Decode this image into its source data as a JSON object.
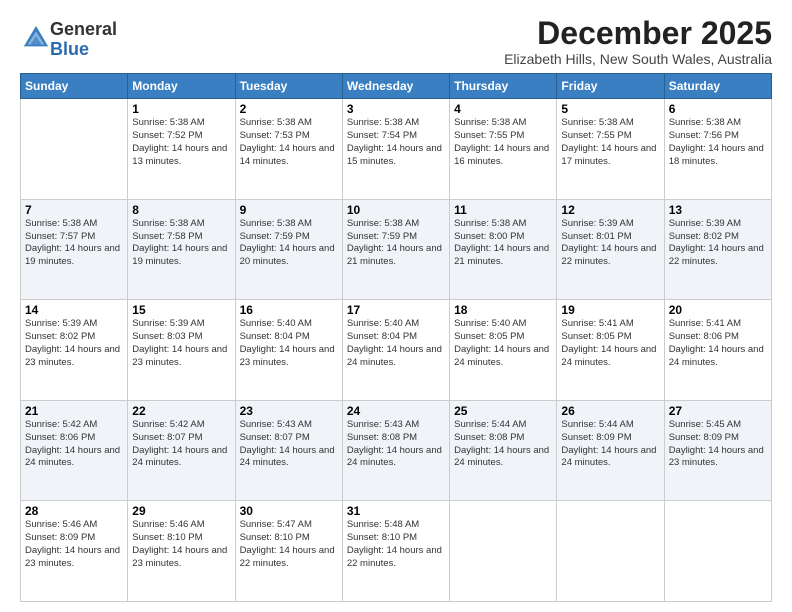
{
  "logo": {
    "general": "General",
    "blue": "Blue"
  },
  "title": {
    "month_year": "December 2025",
    "location": "Elizabeth Hills, New South Wales, Australia"
  },
  "days_of_week": [
    "Sunday",
    "Monday",
    "Tuesday",
    "Wednesday",
    "Thursday",
    "Friday",
    "Saturday"
  ],
  "weeks": [
    [
      {
        "day": "",
        "sunrise": "",
        "sunset": "",
        "daylight": ""
      },
      {
        "day": "1",
        "sunrise": "Sunrise: 5:38 AM",
        "sunset": "Sunset: 7:52 PM",
        "daylight": "Daylight: 14 hours and 13 minutes."
      },
      {
        "day": "2",
        "sunrise": "Sunrise: 5:38 AM",
        "sunset": "Sunset: 7:53 PM",
        "daylight": "Daylight: 14 hours and 14 minutes."
      },
      {
        "day": "3",
        "sunrise": "Sunrise: 5:38 AM",
        "sunset": "Sunset: 7:54 PM",
        "daylight": "Daylight: 14 hours and 15 minutes."
      },
      {
        "day": "4",
        "sunrise": "Sunrise: 5:38 AM",
        "sunset": "Sunset: 7:55 PM",
        "daylight": "Daylight: 14 hours and 16 minutes."
      },
      {
        "day": "5",
        "sunrise": "Sunrise: 5:38 AM",
        "sunset": "Sunset: 7:55 PM",
        "daylight": "Daylight: 14 hours and 17 minutes."
      },
      {
        "day": "6",
        "sunrise": "Sunrise: 5:38 AM",
        "sunset": "Sunset: 7:56 PM",
        "daylight": "Daylight: 14 hours and 18 minutes."
      }
    ],
    [
      {
        "day": "7",
        "sunrise": "Sunrise: 5:38 AM",
        "sunset": "Sunset: 7:57 PM",
        "daylight": "Daylight: 14 hours and 19 minutes."
      },
      {
        "day": "8",
        "sunrise": "Sunrise: 5:38 AM",
        "sunset": "Sunset: 7:58 PM",
        "daylight": "Daylight: 14 hours and 19 minutes."
      },
      {
        "day": "9",
        "sunrise": "Sunrise: 5:38 AM",
        "sunset": "Sunset: 7:59 PM",
        "daylight": "Daylight: 14 hours and 20 minutes."
      },
      {
        "day": "10",
        "sunrise": "Sunrise: 5:38 AM",
        "sunset": "Sunset: 7:59 PM",
        "daylight": "Daylight: 14 hours and 21 minutes."
      },
      {
        "day": "11",
        "sunrise": "Sunrise: 5:38 AM",
        "sunset": "Sunset: 8:00 PM",
        "daylight": "Daylight: 14 hours and 21 minutes."
      },
      {
        "day": "12",
        "sunrise": "Sunrise: 5:39 AM",
        "sunset": "Sunset: 8:01 PM",
        "daylight": "Daylight: 14 hours and 22 minutes."
      },
      {
        "day": "13",
        "sunrise": "Sunrise: 5:39 AM",
        "sunset": "Sunset: 8:02 PM",
        "daylight": "Daylight: 14 hours and 22 minutes."
      }
    ],
    [
      {
        "day": "14",
        "sunrise": "Sunrise: 5:39 AM",
        "sunset": "Sunset: 8:02 PM",
        "daylight": "Daylight: 14 hours and 23 minutes."
      },
      {
        "day": "15",
        "sunrise": "Sunrise: 5:39 AM",
        "sunset": "Sunset: 8:03 PM",
        "daylight": "Daylight: 14 hours and 23 minutes."
      },
      {
        "day": "16",
        "sunrise": "Sunrise: 5:40 AM",
        "sunset": "Sunset: 8:04 PM",
        "daylight": "Daylight: 14 hours and 23 minutes."
      },
      {
        "day": "17",
        "sunrise": "Sunrise: 5:40 AM",
        "sunset": "Sunset: 8:04 PM",
        "daylight": "Daylight: 14 hours and 24 minutes."
      },
      {
        "day": "18",
        "sunrise": "Sunrise: 5:40 AM",
        "sunset": "Sunset: 8:05 PM",
        "daylight": "Daylight: 14 hours and 24 minutes."
      },
      {
        "day": "19",
        "sunrise": "Sunrise: 5:41 AM",
        "sunset": "Sunset: 8:05 PM",
        "daylight": "Daylight: 14 hours and 24 minutes."
      },
      {
        "day": "20",
        "sunrise": "Sunrise: 5:41 AM",
        "sunset": "Sunset: 8:06 PM",
        "daylight": "Daylight: 14 hours and 24 minutes."
      }
    ],
    [
      {
        "day": "21",
        "sunrise": "Sunrise: 5:42 AM",
        "sunset": "Sunset: 8:06 PM",
        "daylight": "Daylight: 14 hours and 24 minutes."
      },
      {
        "day": "22",
        "sunrise": "Sunrise: 5:42 AM",
        "sunset": "Sunset: 8:07 PM",
        "daylight": "Daylight: 14 hours and 24 minutes."
      },
      {
        "day": "23",
        "sunrise": "Sunrise: 5:43 AM",
        "sunset": "Sunset: 8:07 PM",
        "daylight": "Daylight: 14 hours and 24 minutes."
      },
      {
        "day": "24",
        "sunrise": "Sunrise: 5:43 AM",
        "sunset": "Sunset: 8:08 PM",
        "daylight": "Daylight: 14 hours and 24 minutes."
      },
      {
        "day": "25",
        "sunrise": "Sunrise: 5:44 AM",
        "sunset": "Sunset: 8:08 PM",
        "daylight": "Daylight: 14 hours and 24 minutes."
      },
      {
        "day": "26",
        "sunrise": "Sunrise: 5:44 AM",
        "sunset": "Sunset: 8:09 PM",
        "daylight": "Daylight: 14 hours and 24 minutes."
      },
      {
        "day": "27",
        "sunrise": "Sunrise: 5:45 AM",
        "sunset": "Sunset: 8:09 PM",
        "daylight": "Daylight: 14 hours and 23 minutes."
      }
    ],
    [
      {
        "day": "28",
        "sunrise": "Sunrise: 5:46 AM",
        "sunset": "Sunset: 8:09 PM",
        "daylight": "Daylight: 14 hours and 23 minutes."
      },
      {
        "day": "29",
        "sunrise": "Sunrise: 5:46 AM",
        "sunset": "Sunset: 8:10 PM",
        "daylight": "Daylight: 14 hours and 23 minutes."
      },
      {
        "day": "30",
        "sunrise": "Sunrise: 5:47 AM",
        "sunset": "Sunset: 8:10 PM",
        "daylight": "Daylight: 14 hours and 22 minutes."
      },
      {
        "day": "31",
        "sunrise": "Sunrise: 5:48 AM",
        "sunset": "Sunset: 8:10 PM",
        "daylight": "Daylight: 14 hours and 22 minutes."
      },
      {
        "day": "",
        "sunrise": "",
        "sunset": "",
        "daylight": ""
      },
      {
        "day": "",
        "sunrise": "",
        "sunset": "",
        "daylight": ""
      },
      {
        "day": "",
        "sunrise": "",
        "sunset": "",
        "daylight": ""
      }
    ]
  ]
}
